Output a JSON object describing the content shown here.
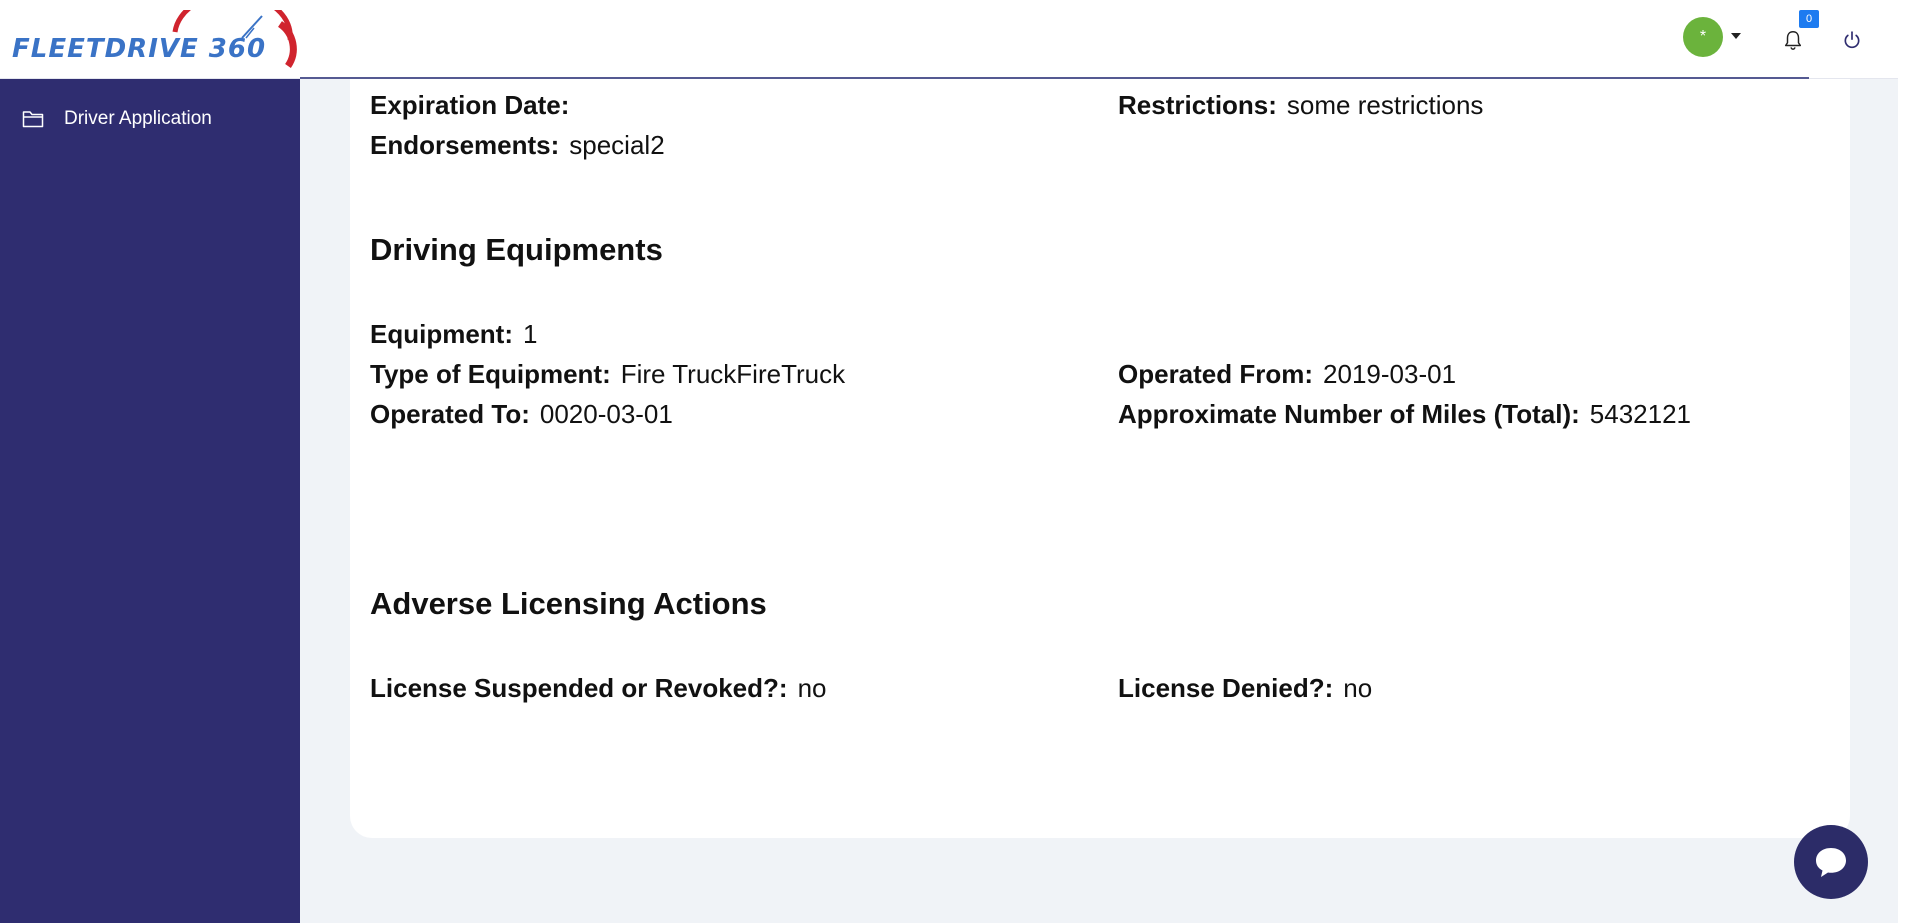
{
  "header": {
    "brand": "FLEETDRIVE 360",
    "notification_count": "0",
    "avatar_initial": "*"
  },
  "sidebar": {
    "items": [
      {
        "label": "Driver Application",
        "icon": "folder-icon"
      }
    ]
  },
  "license": {
    "expiration_label": "Expiration Date:",
    "expiration_value": "",
    "restrictions_label": "Restrictions:",
    "restrictions_value": "some restrictions",
    "endorsements_label": "Endorsements:",
    "endorsements_value": "special2"
  },
  "driving_equipments": {
    "title": "Driving Equipments",
    "equipment_label": "Equipment:",
    "equipment_value": "1",
    "type_label": "Type of Equipment:",
    "type_value": "Fire TruckFireTruck",
    "operated_from_label": "Operated From:",
    "operated_from_value": "2019-03-01",
    "operated_to_label": "Operated To:",
    "operated_to_value": "0020-03-01",
    "miles_label": "Approximate Number of Miles (Total):",
    "miles_value": "5432121"
  },
  "adverse_actions": {
    "title": "Adverse Licensing Actions",
    "suspended_label": "License Suspended or Revoked?:",
    "suspended_value": "no",
    "denied_label": "License Denied?:",
    "denied_value": "no"
  },
  "colors": {
    "sidebar_bg": "#2f2d70",
    "brand_blue": "#3a73c6",
    "brand_red": "#d0242e",
    "avatar_green": "#6bb33c",
    "badge_blue": "#1d7bf0",
    "chat_bg": "#2c2c68"
  }
}
